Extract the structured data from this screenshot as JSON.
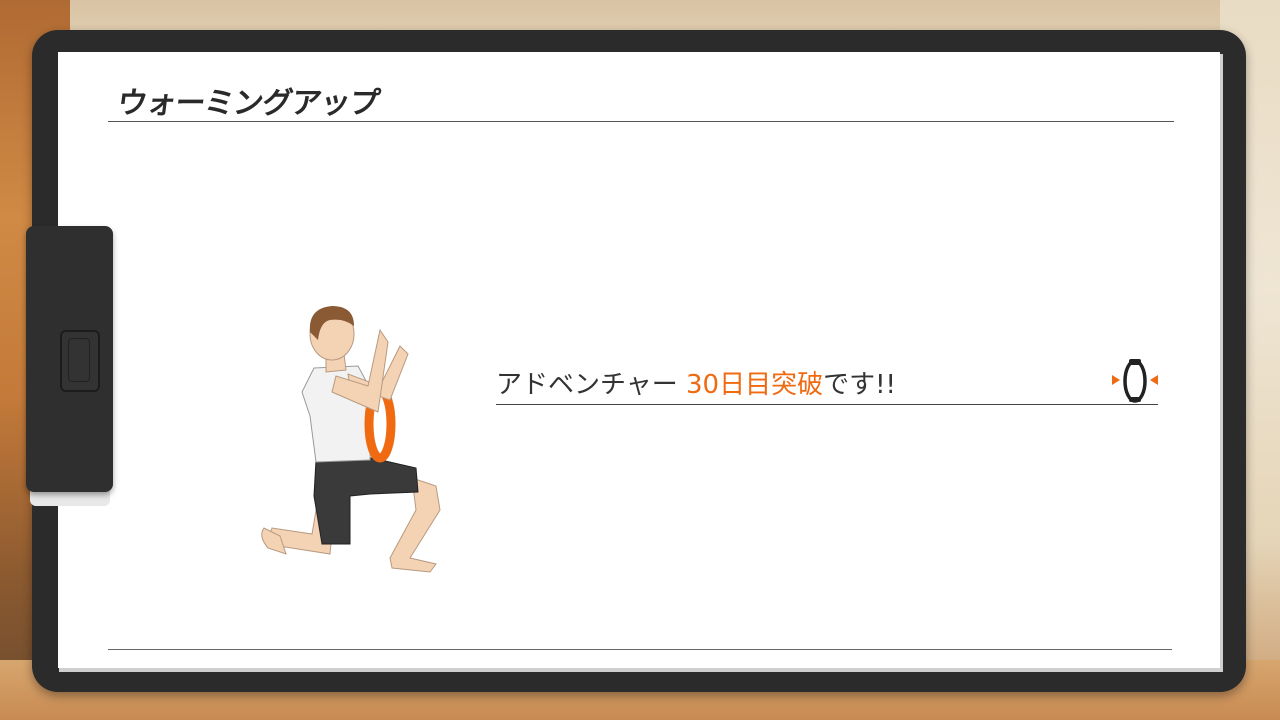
{
  "screen": {
    "title": "ウォーミングアップ",
    "message": {
      "prefix": "アドベンチャー ",
      "highlight": "30日目突破",
      "suffix": "です!!"
    }
  },
  "colors": {
    "accent_orange": "#f06a12",
    "text_dark": "#333333",
    "frame": "#2b2b2b",
    "paper": "#ffffff"
  },
  "icons": {
    "figure": "kneeling-twist-figure",
    "ring": "ring-con-icon"
  }
}
